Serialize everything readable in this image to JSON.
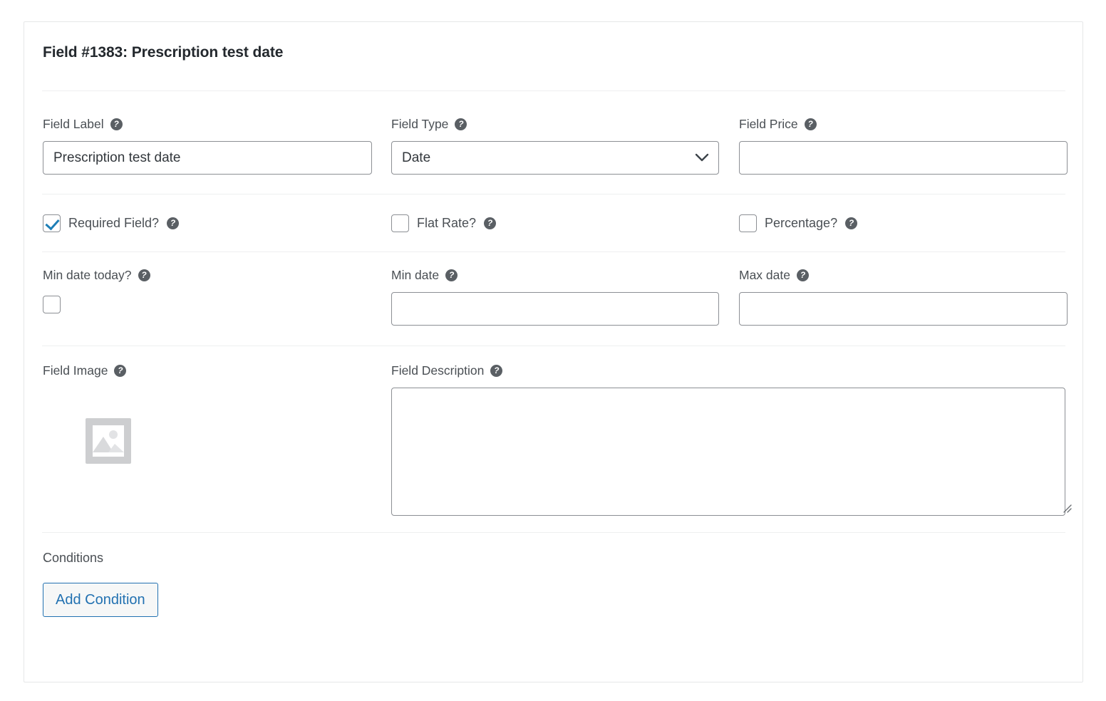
{
  "panel": {
    "title": "Field #1383: Prescription test date"
  },
  "rows": {
    "row1": {
      "field_label": {
        "label": "Field Label",
        "help_icon": "help-icon",
        "value": "Prescription test date",
        "placeholder": ""
      },
      "field_type": {
        "label": "Field Type",
        "help_icon": "help-icon",
        "value": "Date",
        "options": [
          "Date"
        ],
        "chevron_icon": "chevron-down-icon"
      },
      "field_price": {
        "label": "Field Price",
        "help_icon": "help-icon",
        "value": "",
        "placeholder": ""
      }
    },
    "row2": {
      "required_field": {
        "label": "Required Field?",
        "checked": true,
        "help_icon": "help-icon"
      },
      "flat_rate": {
        "label": "Flat Rate?",
        "checked": false,
        "help_icon": "help-icon"
      },
      "percentage": {
        "label": "Percentage?",
        "checked": false,
        "help_icon": "help-icon"
      }
    },
    "row3": {
      "min_date_today": {
        "label": "Min date today?",
        "checked": false,
        "help_icon": "help-icon"
      },
      "min_date": {
        "label": "Min date",
        "help_icon": "help-icon",
        "value": "",
        "placeholder": ""
      },
      "max_date": {
        "label": "Max date",
        "help_icon": "help-icon",
        "value": "",
        "placeholder": ""
      }
    },
    "row4": {
      "field_image": {
        "label": "Field Image",
        "help_icon": "help-icon",
        "placeholder_icon": "image-placeholder-icon"
      },
      "field_description": {
        "label": "Field Description",
        "help_icon": "help-icon",
        "value": "",
        "placeholder": "",
        "resize_icon": "resize-handle-icon"
      }
    },
    "row5": {
      "conditions": {
        "label": "Conditions",
        "add_button": "Add Condition"
      }
    }
  },
  "colors": {
    "accent_blue": "#2271b1",
    "check_blue": "#1d7eb6",
    "border_gray": "#8c8f94",
    "divider_gray": "#eeeff0",
    "text_gray": "#4a4f54",
    "title_dark": "#23282d",
    "placeholder_gray": "#cdced0"
  }
}
